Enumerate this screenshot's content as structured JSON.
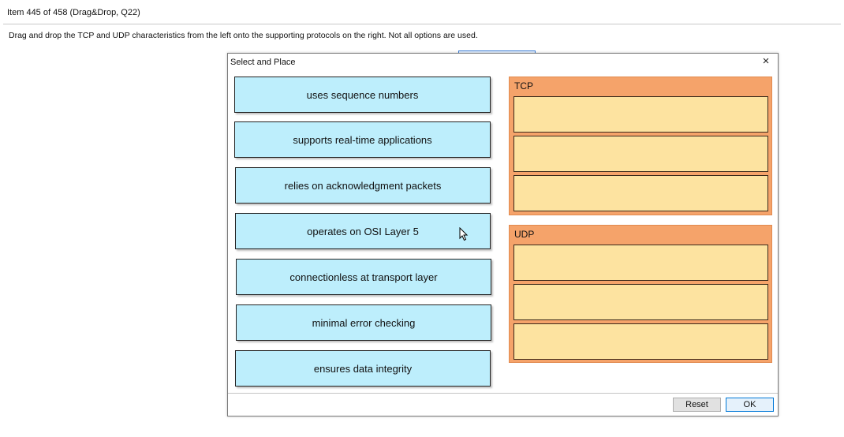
{
  "header": {
    "item_info": "Item 445 of 458  (Drag&Drop, Q22)",
    "instructions": "Drag and drop the TCP and UDP characteristics from the left onto the supporting protocols on the right. Not all options are used."
  },
  "dialog": {
    "title": "Select and Place",
    "close_label": "×"
  },
  "choices": [
    "uses sequence numbers",
    "supports real-time applications",
    "relies on acknowledgment packets",
    "operates on OSI Layer 5",
    "connectionless at transport layer",
    "minimal error checking",
    "ensures data integrity"
  ],
  "targets": {
    "tcp": {
      "label": "TCP",
      "slot_count": 3
    },
    "udp": {
      "label": "UDP",
      "slot_count": 3
    }
  },
  "buttons": {
    "reset": "Reset",
    "ok": "OK"
  },
  "colors": {
    "choice_bg": "#bdeefc",
    "target_bg": "#f5a36a",
    "slot_bg": "#fde3a0",
    "ok_border": "#0078d7"
  }
}
